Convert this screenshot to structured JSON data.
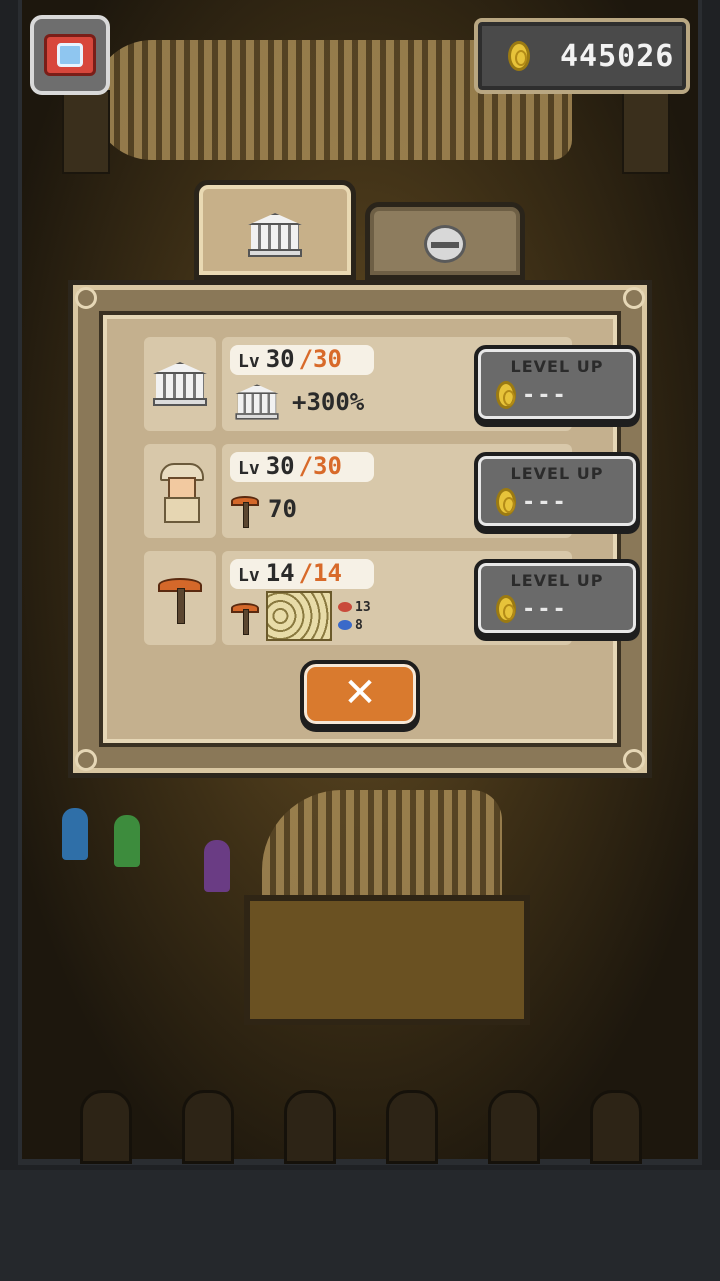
{
  "hud": {
    "camera_icon": "camera-icon",
    "coins": "445026"
  },
  "tabs": [
    {
      "icon": "museum-icon",
      "active": true
    },
    {
      "icon": "helmet-icon",
      "active": false
    }
  ],
  "upgrades": [
    {
      "icon": "museum-icon",
      "lv_prefix": "Lv",
      "level": "30",
      "max": "/30",
      "effect": "+300%",
      "button_label": "LEVEL UP",
      "cost": "---"
    },
    {
      "icon": "explorer-icon",
      "lv_prefix": "Lv",
      "level": "30",
      "max": "/30",
      "effect": "70",
      "button_label": "LEVEL UP",
      "cost": "---"
    },
    {
      "icon": "pickaxe-icon",
      "lv_prefix": "Lv",
      "level": "14",
      "max": "/14",
      "effect_a": "13",
      "effect_b": "8",
      "button_label": "LEVEL UP",
      "cost": "---"
    }
  ],
  "close": {
    "label": "✕"
  },
  "colors": {
    "accent": "#d97a2e",
    "panel": "#c4b08e",
    "max_level": "#d86a2a"
  }
}
